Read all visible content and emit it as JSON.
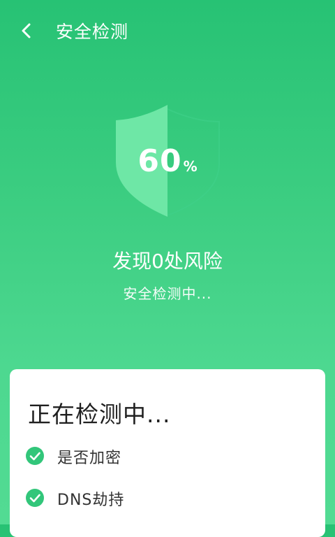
{
  "header": {
    "title": "安全检测",
    "back_icon": "chevron-left-icon"
  },
  "scan": {
    "progress_value": "60",
    "progress_unit": "%",
    "risk_text": "发现0处风险",
    "status_text": "安全检测中..."
  },
  "card": {
    "title": "正在检测中...",
    "items": [
      {
        "label": "是否加密",
        "icon": "check-circle-icon"
      },
      {
        "label": "DNS劫持",
        "icon": "check-circle-icon"
      }
    ]
  },
  "colors": {
    "accent": "#27c274",
    "shield_light": "#6ee7a6",
    "shield_outline": "#3fd08a",
    "check": "#32c67a"
  }
}
